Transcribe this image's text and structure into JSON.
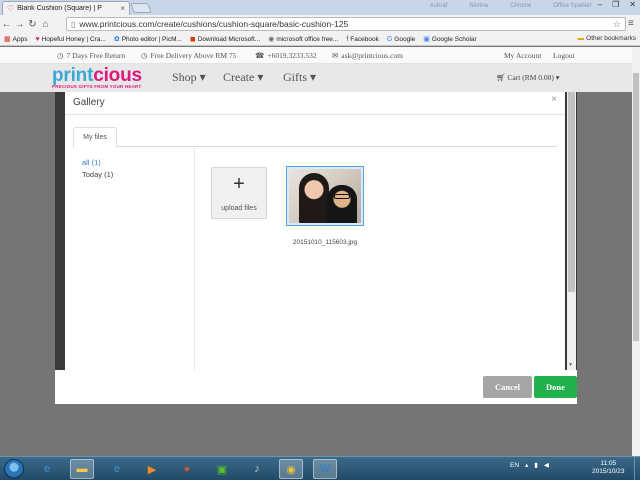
{
  "browser": {
    "tab_title": "Blank Cushion (Square) | P",
    "tab_close": "×",
    "ghost_tabs": [
      "Ashraf",
      "Nisrina",
      "Chrome",
      "Office Sparker"
    ],
    "window_controls": [
      "–",
      "❐",
      "✕"
    ],
    "url": "www.printcious.com/create/cushions/cushion-square/basic-cushion-125",
    "bookmarks": [
      {
        "icon": "apps-icon",
        "label": "Apps",
        "glyph": "▦",
        "color": "#d93025"
      },
      {
        "icon": "heart-icon",
        "label": "Hopeful Honey | Cra...",
        "glyph": "♥",
        "color": "#e0187c"
      },
      {
        "icon": "photo-icon",
        "label": "Photo editor | PicM...",
        "glyph": "✿",
        "color": "#1a73e8"
      },
      {
        "icon": "download-icon",
        "label": "Download Microsoft...",
        "glyph": "◼",
        "color": "#d83b01"
      },
      {
        "icon": "office-icon",
        "label": "microsoft office free...",
        "glyph": "◉",
        "color": "#6b6b6b"
      },
      {
        "icon": "facebook-icon",
        "label": "Facebook",
        "glyph": "f",
        "color": "#3b5998"
      },
      {
        "icon": "google-icon",
        "label": "Google",
        "glyph": "G",
        "color": "#4285f4"
      },
      {
        "icon": "scholar-icon",
        "label": "Google Scholar",
        "glyph": "▣",
        "color": "#4285f4"
      }
    ],
    "other_bookmarks": "Other bookmarks"
  },
  "site": {
    "topbar": {
      "return": "7 Days Free Return",
      "delivery": "Free Delivery Above RM 75",
      "phone": "+6019.3233.532",
      "email": "ask@printcious.com",
      "account": "My Account",
      "logout": "Logout"
    },
    "logo": {
      "brand_a": "print",
      "brand_b": "cious",
      "tagline": "PRECIOUS GIFTS FROM YOUR HEART"
    },
    "nav": {
      "shop": "Shop ▾",
      "create": "Create ▾",
      "gifts": "Gifts ▾"
    },
    "cart": "Cart (RM 0.00) ▾"
  },
  "gallery": {
    "title": "Gallery",
    "close": "×",
    "tab": "My files",
    "folders": [
      {
        "label": "all (1)",
        "color": "#3a7bd5"
      },
      {
        "label": "Today (1)",
        "color": "#444444"
      }
    ],
    "upload_plus": "+",
    "upload_label": "upload files",
    "file_name": "20151010_115603.jpg",
    "cancel": "Cancel",
    "done": "Done"
  },
  "taskbar": {
    "icons": [
      {
        "name": "ie-icon",
        "glyph": "e",
        "color": "#3b8fe0"
      },
      {
        "name": "explorer-icon",
        "glyph": "▬",
        "color": "#f2c94c"
      },
      {
        "name": "ie-icon-2",
        "glyph": "e",
        "color": "#3b8fe0"
      },
      {
        "name": "media-player-icon",
        "glyph": "▶",
        "color": "#f08a24"
      },
      {
        "name": "photo-app-icon",
        "glyph": "✦",
        "color": "#e0523a"
      },
      {
        "name": "iqiyi-icon",
        "glyph": "▣",
        "color": "#56c02a"
      },
      {
        "name": "itunes-icon",
        "glyph": "♪",
        "color": "#cccccc"
      },
      {
        "name": "chrome-icon",
        "glyph": "◉",
        "color": "#e8c238"
      },
      {
        "name": "word-icon",
        "glyph": "W",
        "color": "#2b7cd3"
      }
    ],
    "language": "EN",
    "time": "11:05",
    "date": "2015/10/23"
  }
}
